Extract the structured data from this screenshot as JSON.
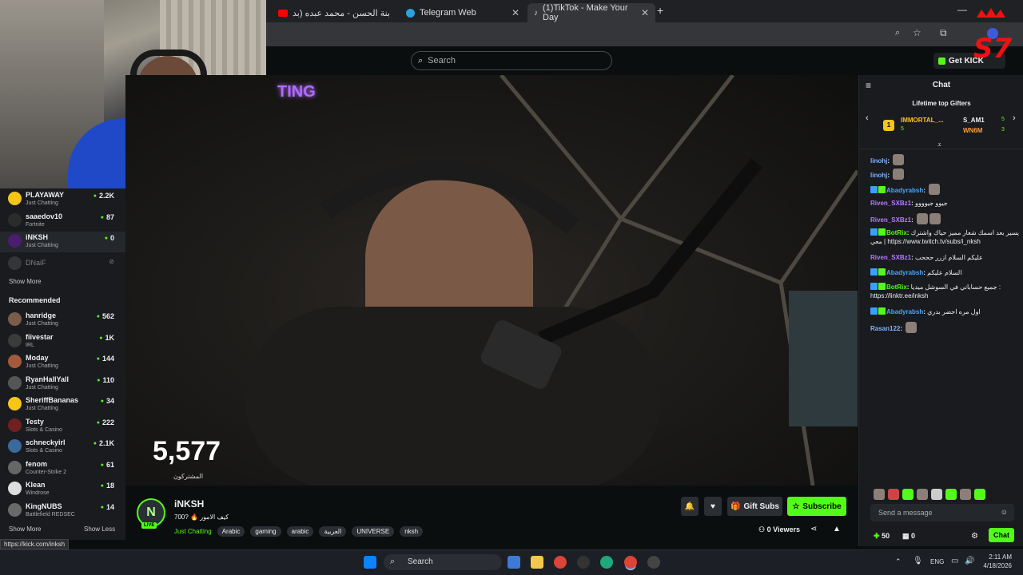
{
  "browser": {
    "tabs": [
      {
        "title": "بنة الحسن - محمد عبده (بدون مو..."
      },
      {
        "title": "Telegram Web"
      },
      {
        "title": "(1)TikTok - Make Your Day"
      }
    ],
    "new_tab": "+",
    "status_url": "https://kick.com/inksh"
  },
  "topbar": {
    "search_placeholder": "Search",
    "get_kick": "Get KICK"
  },
  "sidebar": {
    "following": [
      {
        "name": "PLAYAWAY",
        "category": "Just Chatting",
        "viewers": "2.2K"
      },
      {
        "name": "saaedov10",
        "category": "Fortnite",
        "viewers": "87"
      },
      {
        "name": "iNKSH",
        "category": "Just Chatting",
        "viewers": "0"
      },
      {
        "name": "DNaiF",
        "category": "",
        "viewers": ""
      }
    ],
    "show_more": "Show More",
    "recommended_title": "Recommended",
    "recommended": [
      {
        "name": "hanridge",
        "category": "Just Chatting",
        "viewers": "562"
      },
      {
        "name": "fiivestar",
        "category": "IRL",
        "viewers": "1K"
      },
      {
        "name": "Moday",
        "category": "Just Chatting",
        "viewers": "144"
      },
      {
        "name": "RyanHallYall",
        "category": "Just Chatting",
        "viewers": "110"
      },
      {
        "name": "SheriffBananas",
        "category": "Just Chatting",
        "viewers": "34"
      },
      {
        "name": "Testy",
        "category": "Slots & Casino",
        "viewers": "222"
      },
      {
        "name": "schneckyirl",
        "category": "Slots & Casino",
        "viewers": "2.1K"
      },
      {
        "name": "fenom",
        "category": "Counter-Strike 2",
        "viewers": "61"
      },
      {
        "name": "Klean",
        "category": "Windrose",
        "viewers": "18"
      },
      {
        "name": "KingNUBS",
        "category": "Battlefield REDSEC",
        "viewers": "14"
      }
    ],
    "show_more_2": "Show More",
    "show_less": "Show Less"
  },
  "video": {
    "overlay_text": "TING",
    "sub_count": "5,577",
    "sub_label": "المشتركون"
  },
  "stream": {
    "channel": "iNKSH",
    "live": "LIVE",
    "title": "700? 🔥 كيف الامور",
    "category": "Just Chatting",
    "tags": [
      "Arabic",
      "gaming",
      "arabic",
      "العربية",
      "UNIVERSE",
      "nksh"
    ],
    "gift_subs": "Gift Subs",
    "subscribe": "Subscribe",
    "viewers": "0 Viewers"
  },
  "chat": {
    "title": "Chat",
    "gifters_title": "Lifetime top Gifters",
    "gifters": [
      {
        "name": "IMMORTAL_...",
        "count": "5"
      },
      {
        "name": "S_AM1",
        "count": "5"
      },
      {
        "name": "WN6M",
        "count": "3"
      }
    ],
    "messages": [
      {
        "user": "linohj",
        "color": "#7fb3ff",
        "text": ""
      },
      {
        "user": "linohj",
        "color": "#7fb3ff",
        "text": ""
      },
      {
        "user": "Abadyrabsh",
        "color": "#4aa3ff",
        "text": ""
      },
      {
        "user": "Riven_SXBz1",
        "color": "#b57bff",
        "text": "جيوو جيوووو"
      },
      {
        "user": "Riven_SXBz1",
        "color": "#b57bff",
        "text": ""
      },
      {
        "user": "BotRix",
        "color": "#53fc18",
        "text": "يسير بعد اسمك شعار مميز حياك واشترك معي | https://www.twitch.tv/subs/i_nksh"
      },
      {
        "user": "Riven_SXBz1",
        "color": "#b57bff",
        "text": "عليكم السلام ازرر حححب"
      },
      {
        "user": "Abadyrabsh",
        "color": "#4aa3ff",
        "text": "السلام عليكم"
      },
      {
        "user": "BotRix",
        "color": "#53fc18",
        "text": "جميع حساباتي في السوشل ميديا : https://linktr.ee/inksh"
      },
      {
        "user": "Abadyrabsh",
        "color": "#4aa3ff",
        "text": "اول مره احضر بدري"
      },
      {
        "user": "Rasan122",
        "color": "#7fb3ff",
        "text": ""
      }
    ],
    "input_placeholder": "Send a message",
    "points": "50",
    "store": "0",
    "send": "Chat"
  },
  "taskbar": {
    "search": "Search",
    "lang": "ENG",
    "time": "2:11 AM",
    "date": "4/18/2026"
  },
  "colors": {
    "accent": "#53fc18",
    "bg": "#0b0e0f",
    "panel": "#191b1f"
  }
}
